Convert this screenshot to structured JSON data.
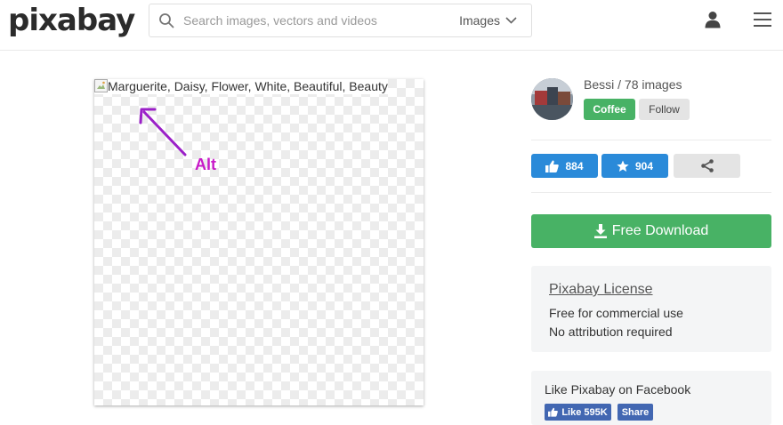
{
  "header": {
    "logo": "pixabay",
    "search_placeholder": "Search images, vectors and videos",
    "search_type": "Images"
  },
  "image": {
    "alt": "Marguerite, Daisy, Flower, White, Beautiful, Beauty",
    "annotation": "Alt"
  },
  "author": {
    "name_line": "Bessi / 78 images",
    "coffee_label": "Coffee",
    "follow_label": "Follow"
  },
  "stats": {
    "likes": "884",
    "favorites": "904"
  },
  "download_label": "Free Download",
  "license": {
    "title": "Pixabay License",
    "line1": "Free for commercial use",
    "line2": "No attribution required"
  },
  "facebook": {
    "text": "Like Pixabay on Facebook",
    "like_label": "Like 595K",
    "share_label": "Share"
  },
  "colors": {
    "green": "#48b265",
    "blue": "#2a8ad9",
    "facebook": "#4267b2",
    "annotation": "#c81ac8"
  },
  "icons": [
    "search-icon",
    "chevron-down-icon",
    "user-icon",
    "menu-icon",
    "broken-image-icon",
    "thumbs-up-icon",
    "star-icon",
    "share-icon",
    "download-icon",
    "facebook-thumbs-up-icon"
  ]
}
